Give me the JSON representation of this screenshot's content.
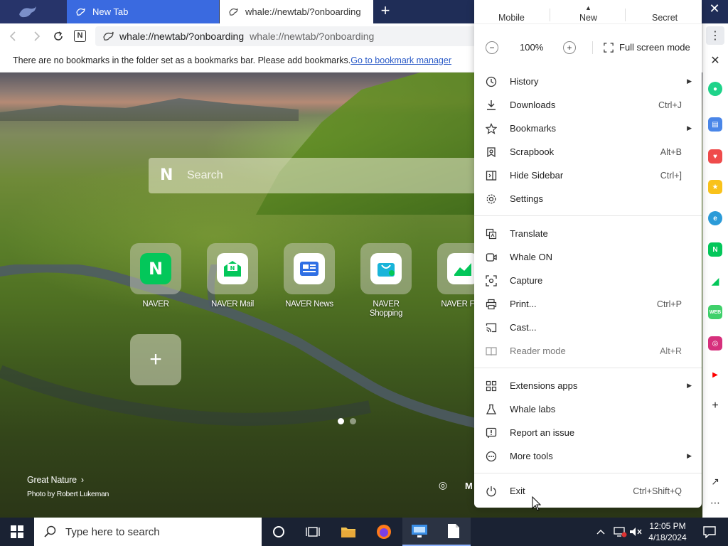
{
  "tabs": [
    {
      "title": "New Tab",
      "active": false
    },
    {
      "title": "whale://newtab/?onboarding",
      "active": true
    }
  ],
  "addressbar": {
    "url": "whale://newtab/?onboarding",
    "url_suggestion": "whale://newtab/?onboarding"
  },
  "bookmarkbar": {
    "message": "There are no bookmarks in the folder set as a bookmarks bar. Please add bookmarks.",
    "link": "Go to bookmark manager"
  },
  "ntp": {
    "search_placeholder": "Search",
    "search_logo": "N",
    "tiles": [
      {
        "label": "NAVER",
        "icon": "naver-icon",
        "color": "#03c75a"
      },
      {
        "label": "NAVER Mail",
        "icon": "naver-mail-icon",
        "color": "#03c75a"
      },
      {
        "label": "NAVER News",
        "icon": "naver-news-icon",
        "color": "#2f6fe4"
      },
      {
        "label": "NAVER Shopping",
        "icon": "naver-shopping-icon",
        "color": "#19b4d9"
      },
      {
        "label": "NAVER Fina",
        "icon": "naver-finance-icon",
        "color": "#03c75a"
      }
    ],
    "add_tile_label": "+",
    "caption_title": "Great Nature",
    "caption_credit": "Photo by Robert Lukeman",
    "corner_label": "M"
  },
  "menu": {
    "top_tabs": [
      "Mobile",
      "New",
      "Secret"
    ],
    "zoom_minus": "−",
    "zoom_value": "100%",
    "zoom_plus": "+",
    "fullscreen_label": "Full screen mode",
    "sections": [
      [
        {
          "label": "History",
          "shortcut": "",
          "submenu": true,
          "icon": "history-icon"
        },
        {
          "label": "Downloads",
          "shortcut": "Ctrl+J",
          "submenu": false,
          "icon": "download-icon"
        },
        {
          "label": "Bookmarks",
          "shortcut": "",
          "submenu": true,
          "icon": "star-icon"
        },
        {
          "label": "Scrapbook",
          "shortcut": "Alt+B",
          "submenu": false,
          "icon": "scrapbook-icon"
        },
        {
          "label": "Hide Sidebar",
          "shortcut": "Ctrl+]",
          "submenu": false,
          "icon": "sidebar-icon"
        },
        {
          "label": "Settings",
          "shortcut": "",
          "submenu": false,
          "icon": "gear-icon"
        }
      ],
      [
        {
          "label": "Translate",
          "shortcut": "",
          "submenu": false,
          "icon": "translate-icon"
        },
        {
          "label": "Whale ON",
          "shortcut": "",
          "submenu": false,
          "icon": "whale-on-icon"
        },
        {
          "label": "Capture",
          "shortcut": "",
          "submenu": false,
          "icon": "capture-icon"
        },
        {
          "label": "Print...",
          "shortcut": "Ctrl+P",
          "submenu": false,
          "icon": "print-icon"
        },
        {
          "label": "Cast...",
          "shortcut": "",
          "submenu": false,
          "icon": "cast-icon"
        },
        {
          "label": "Reader mode",
          "shortcut": "Alt+R",
          "submenu": false,
          "icon": "reader-icon",
          "disabled": true
        }
      ],
      [
        {
          "label": "Extensions apps",
          "shortcut": "",
          "submenu": true,
          "icon": "extensions-icon"
        },
        {
          "label": "Whale labs",
          "shortcut": "",
          "submenu": false,
          "icon": "flask-icon"
        },
        {
          "label": "Report an issue",
          "shortcut": "",
          "submenu": false,
          "icon": "report-icon"
        },
        {
          "label": "More tools",
          "shortcut": "",
          "submenu": true,
          "icon": "more-tools-icon"
        }
      ],
      [
        {
          "label": "Exit",
          "shortcut": "Ctrl+Shift+Q",
          "submenu": false,
          "icon": "power-icon"
        }
      ]
    ]
  },
  "taskbar": {
    "search_placeholder": "Type here to search",
    "time": "12:05 PM",
    "date": "4/18/2024"
  },
  "colors": {
    "tab_inactive": "#3a6ae0",
    "tabbar": "#1f2d57",
    "link": "#2a5ac7",
    "taskbar": "#1a2233"
  }
}
